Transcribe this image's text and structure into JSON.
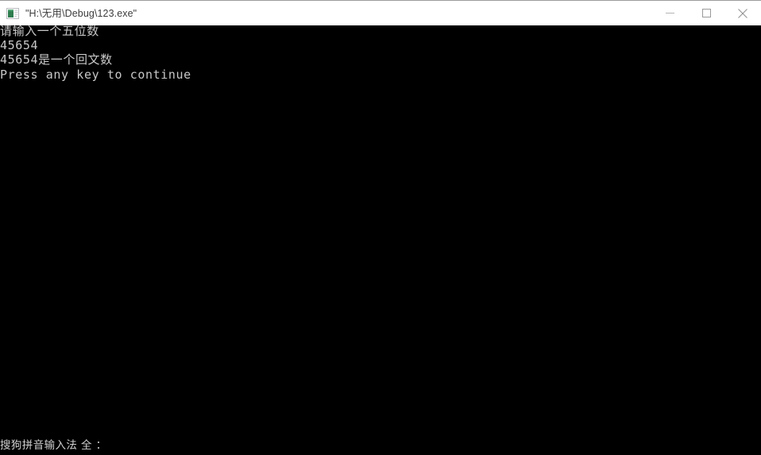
{
  "window": {
    "title": "\"H:\\无用\\Debug\\123.exe\"",
    "icon": "console-app-icon",
    "background_color": "#000000",
    "titlebar_color": "#ffffff",
    "titlebar_text_color": "#3b3b3b"
  },
  "window_controls": {
    "minimize": {
      "name": "minimize-icon",
      "label": "Minimize"
    },
    "maximize": {
      "name": "maximize-icon",
      "label": "Maximize"
    },
    "close": {
      "name": "close-icon",
      "label": "Close"
    }
  },
  "console": {
    "foreground_color": "#c8c8c8",
    "background_color": "#000000",
    "lines": [
      "请输入一个五位数",
      "45654",
      "45654是一个回文数",
      "Press any key to continue"
    ]
  },
  "ime_status": {
    "text": "搜狗拼音输入法 全 ："
  }
}
